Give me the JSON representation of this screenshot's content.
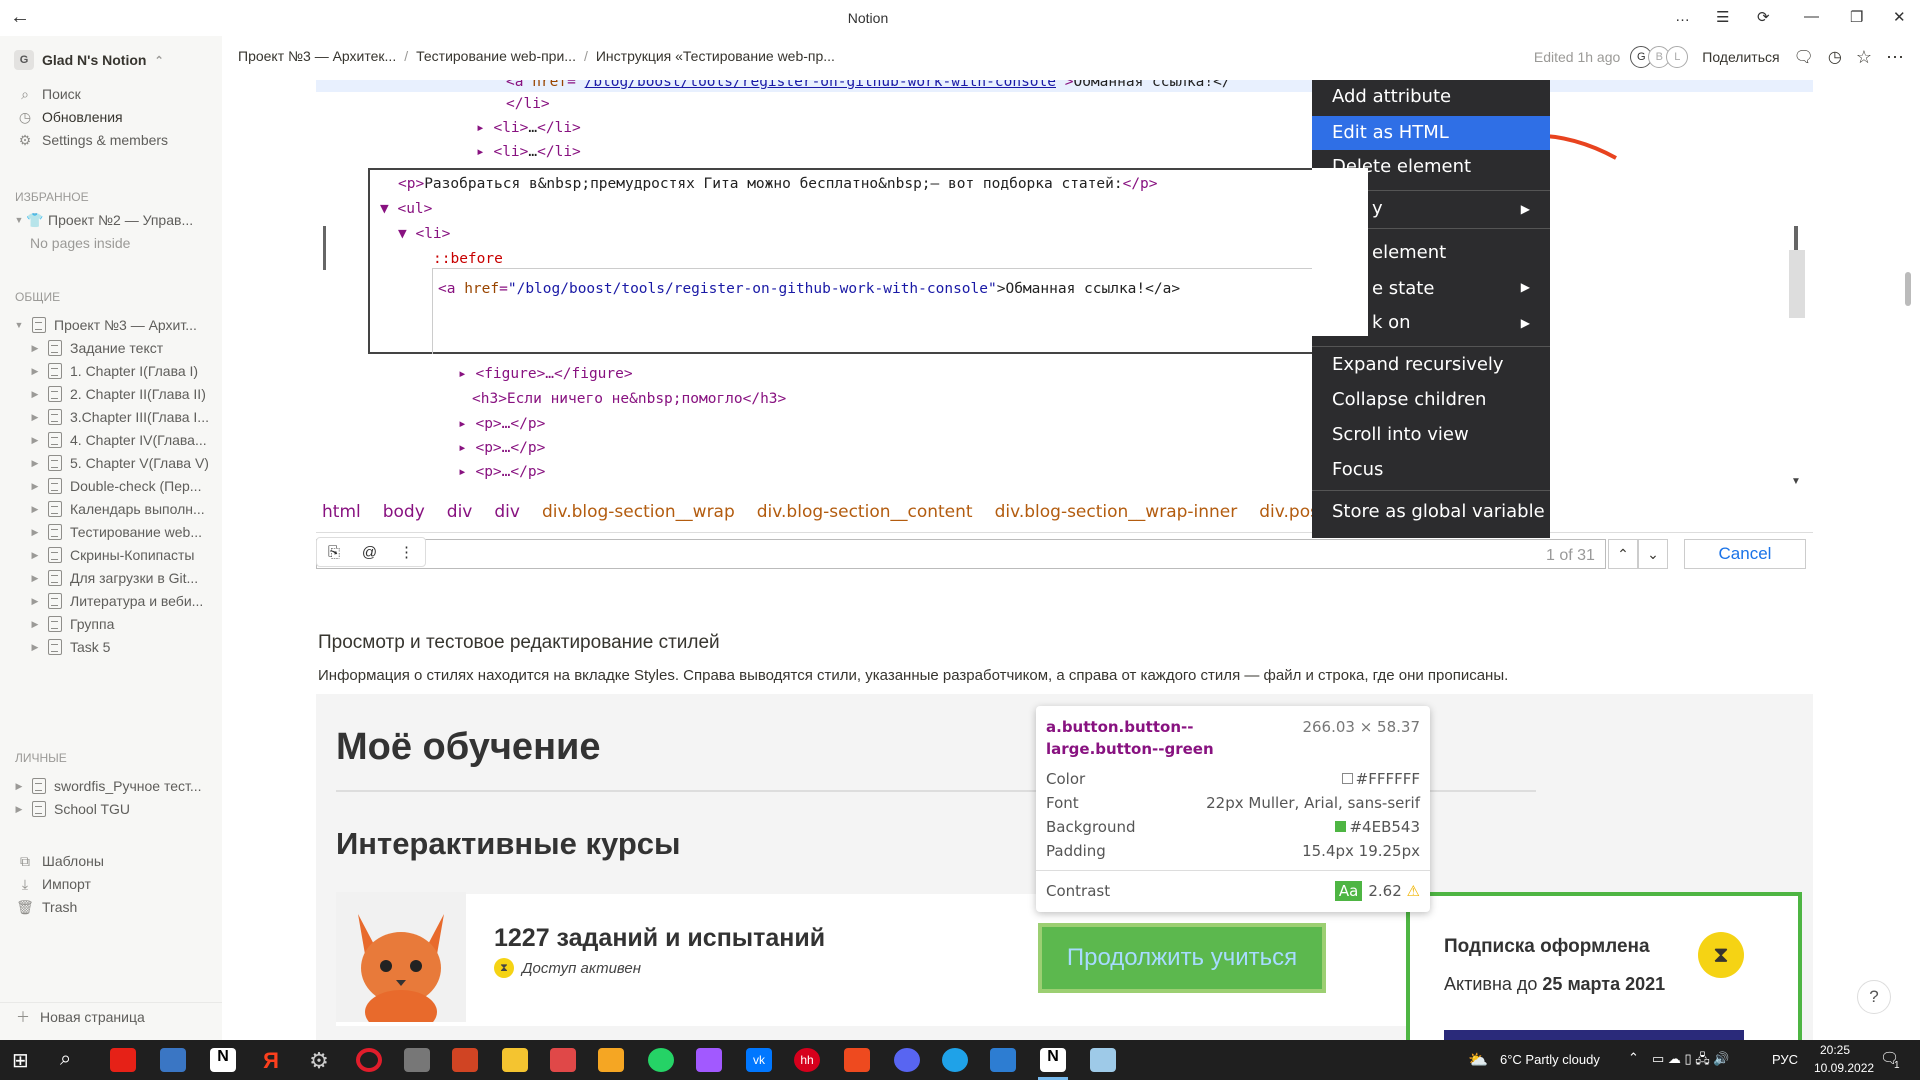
{
  "window": {
    "title": "Notion"
  },
  "sidebar": {
    "workspace": "Glad N's Notion",
    "workspace_initial": "G",
    "top_items": [
      {
        "label": "Поиск",
        "icon": "search-icon"
      },
      {
        "label": "Обновления",
        "icon": "clock-icon"
      },
      {
        "label": "Settings & members",
        "icon": "gear-icon"
      }
    ],
    "favorites_header": "ИЗБРАННОЕ",
    "favorites": [
      {
        "label": "Проект №2 — Управ...",
        "sub": "No pages inside"
      }
    ],
    "shared_header": "ОБЩИЕ",
    "shared_root": "Проект №3 — Архит...",
    "shared_children": [
      "Задание текст",
      "1. Chapter I(Глава I)",
      "2. Chapter II(Глава II)",
      "3.Chapter III(Глава I...",
      "4. Chapter IV(Глава...",
      "5. Chapter V(Глава V)",
      "Double-check (Пер...",
      "Календарь выполн...",
      "Тестирование web...",
      "Скрины-Копипасты",
      "Для загрузки в Git...",
      "Литература и веби...",
      "Группа",
      "Task 5"
    ],
    "private_header": "ЛИЧНЫЕ",
    "private": [
      "swordfis_Ручное тест...",
      "School TGU"
    ],
    "bottom_items": [
      {
        "label": "Шаблоны",
        "icon": "templates-icon"
      },
      {
        "label": "Импорт",
        "icon": "import-icon"
      },
      {
        "label": "Trash",
        "icon": "trash-icon"
      }
    ],
    "new_page": "Новая страница"
  },
  "header": {
    "breadcrumbs": [
      "Проект №3 — Архитек...",
      "Тестирование web-при...",
      "Инструкция «Тестирование web-пр..."
    ],
    "edited": "Edited 1h ago",
    "avatars": [
      "G",
      "B",
      "L"
    ],
    "share": "Поделиться"
  },
  "devtools": {
    "lines": [
      {
        "indent": 0,
        "parts": [
          [
            "tag",
            "<a "
          ],
          [
            "attr",
            "href"
          ],
          [
            "tag",
            "=\""
          ],
          [
            "val",
            "/blog/boost/tools/register-on-github-work-with-console"
          ],
          [
            "tag",
            "\">"
          ],
          [
            "txt",
            "Обманная ссылка!</"
          ]
        ]
      },
      {
        "indent": 1,
        "parts": [
          [
            "tag",
            "</li>"
          ]
        ]
      },
      {
        "indent": 1,
        "parts": [
          [
            "tag",
            "▸ <li>"
          ],
          [
            "txt",
            "…"
          ],
          [
            "tag",
            "</li>"
          ]
        ]
      },
      {
        "indent": 1,
        "parts": [
          [
            "tag",
            "▸ <li>"
          ],
          [
            "txt",
            "…"
          ],
          [
            "tag",
            "</li>"
          ]
        ]
      }
    ],
    "editor": {
      "line1_tag_open": "<p>",
      "line1_text": "Разобраться в&nbsp;премудростях Гита можно бесплатно&nbsp;— вот подборка статей:",
      "line1_tag_close": "</p>",
      "line2": "▼ <ul>",
      "line3": "▼ <li>",
      "line4": "::before",
      "line5_open": "<a ",
      "line5_attr": "href",
      "line5_val": "\"/blog/boost/tools/register-on-github-work-with-console\"",
      "line5_text": ">Обманная ссылка!</a>"
    },
    "lower_lines": [
      {
        "indent": 0,
        "text": "▸ <figure>…</figure>"
      },
      {
        "indent": 0,
        "text": "<h3>Если ничего не&nbsp;помогло</h3>"
      },
      {
        "indent": 0,
        "text": "▸ <p>…</p>"
      },
      {
        "indent": 0,
        "text": "▸ <p>…</p>"
      },
      {
        "indent": 0,
        "text": "▸ <p>…</p>"
      }
    ],
    "breadcrumb_path": [
      "html",
      "body",
      "div",
      "div",
      "div.blog-section__wrap",
      "div.blog-section__content",
      "div.blog-section__wrap-inner",
      "div.post-content"
    ],
    "search_count": "1 of 31",
    "cancel": "Cancel"
  },
  "context_menu": {
    "items": [
      {
        "label": "Add attribute",
        "arrow": false
      },
      {
        "label": "Edit as HTML",
        "arrow": false,
        "highlighted": true
      },
      {
        "label": "Delete element",
        "arrow": false
      },
      {
        "label": "y",
        "arrow": true
      },
      {
        "label": "element",
        "arrow": false
      },
      {
        "label": "e state",
        "arrow": true
      },
      {
        "label": "k on",
        "arrow": true
      },
      {
        "label": "Expand recursively",
        "arrow": false
      },
      {
        "label": "Collapse children",
        "arrow": false
      },
      {
        "label": "Scroll into view",
        "arrow": false
      },
      {
        "label": "Focus",
        "arrow": false
      },
      {
        "label": "Store as global variable",
        "arrow": false
      }
    ]
  },
  "content": {
    "heading": "Просмотр и тестовое редактирование стилей",
    "paragraph": "Информация о стилях находится на вкладке Styles. Справа выводятся стили, указанные разработчиком, а справа от каждого стиля — файл и строка, где они прописаны.",
    "shot2": {
      "title1": "Моё обучение",
      "title2": "Интерактивные курсы",
      "tasks": "1227 заданий и испытаний",
      "access": "Доступ активен",
      "button": "Продолжить учиться",
      "sub_title": "Подписка оформлена",
      "sub_active_pre": "Активна до ",
      "sub_active_date": "25 марта 2021"
    },
    "tooltip": {
      "selector": "a.button.button--large.button--green",
      "size": "266.03 × 58.37",
      "rows": [
        {
          "k": "Color",
          "v": "#FFFFFF"
        },
        {
          "k": "Font",
          "v": "22px Muller, Arial, sans-serif"
        },
        {
          "k": "Background",
          "v": "#4EB543"
        },
        {
          "k": "Padding",
          "v": "15.4px 19.25px"
        }
      ],
      "contrast_label": "Contrast",
      "contrast_aa": "Aa",
      "contrast_value": "2.62"
    },
    "help": "?"
  },
  "taskbar": {
    "weather": "6°C  Partly cloudy",
    "lang": "РУС",
    "time": "20:25",
    "date": "10.09.2022",
    "notif": "1"
  },
  "colors": {
    "menu_bg": "#2c2c2e",
    "menu_highlight": "#2f6fe6",
    "green": "#4eb543",
    "arrow_red": "#e8431f"
  }
}
